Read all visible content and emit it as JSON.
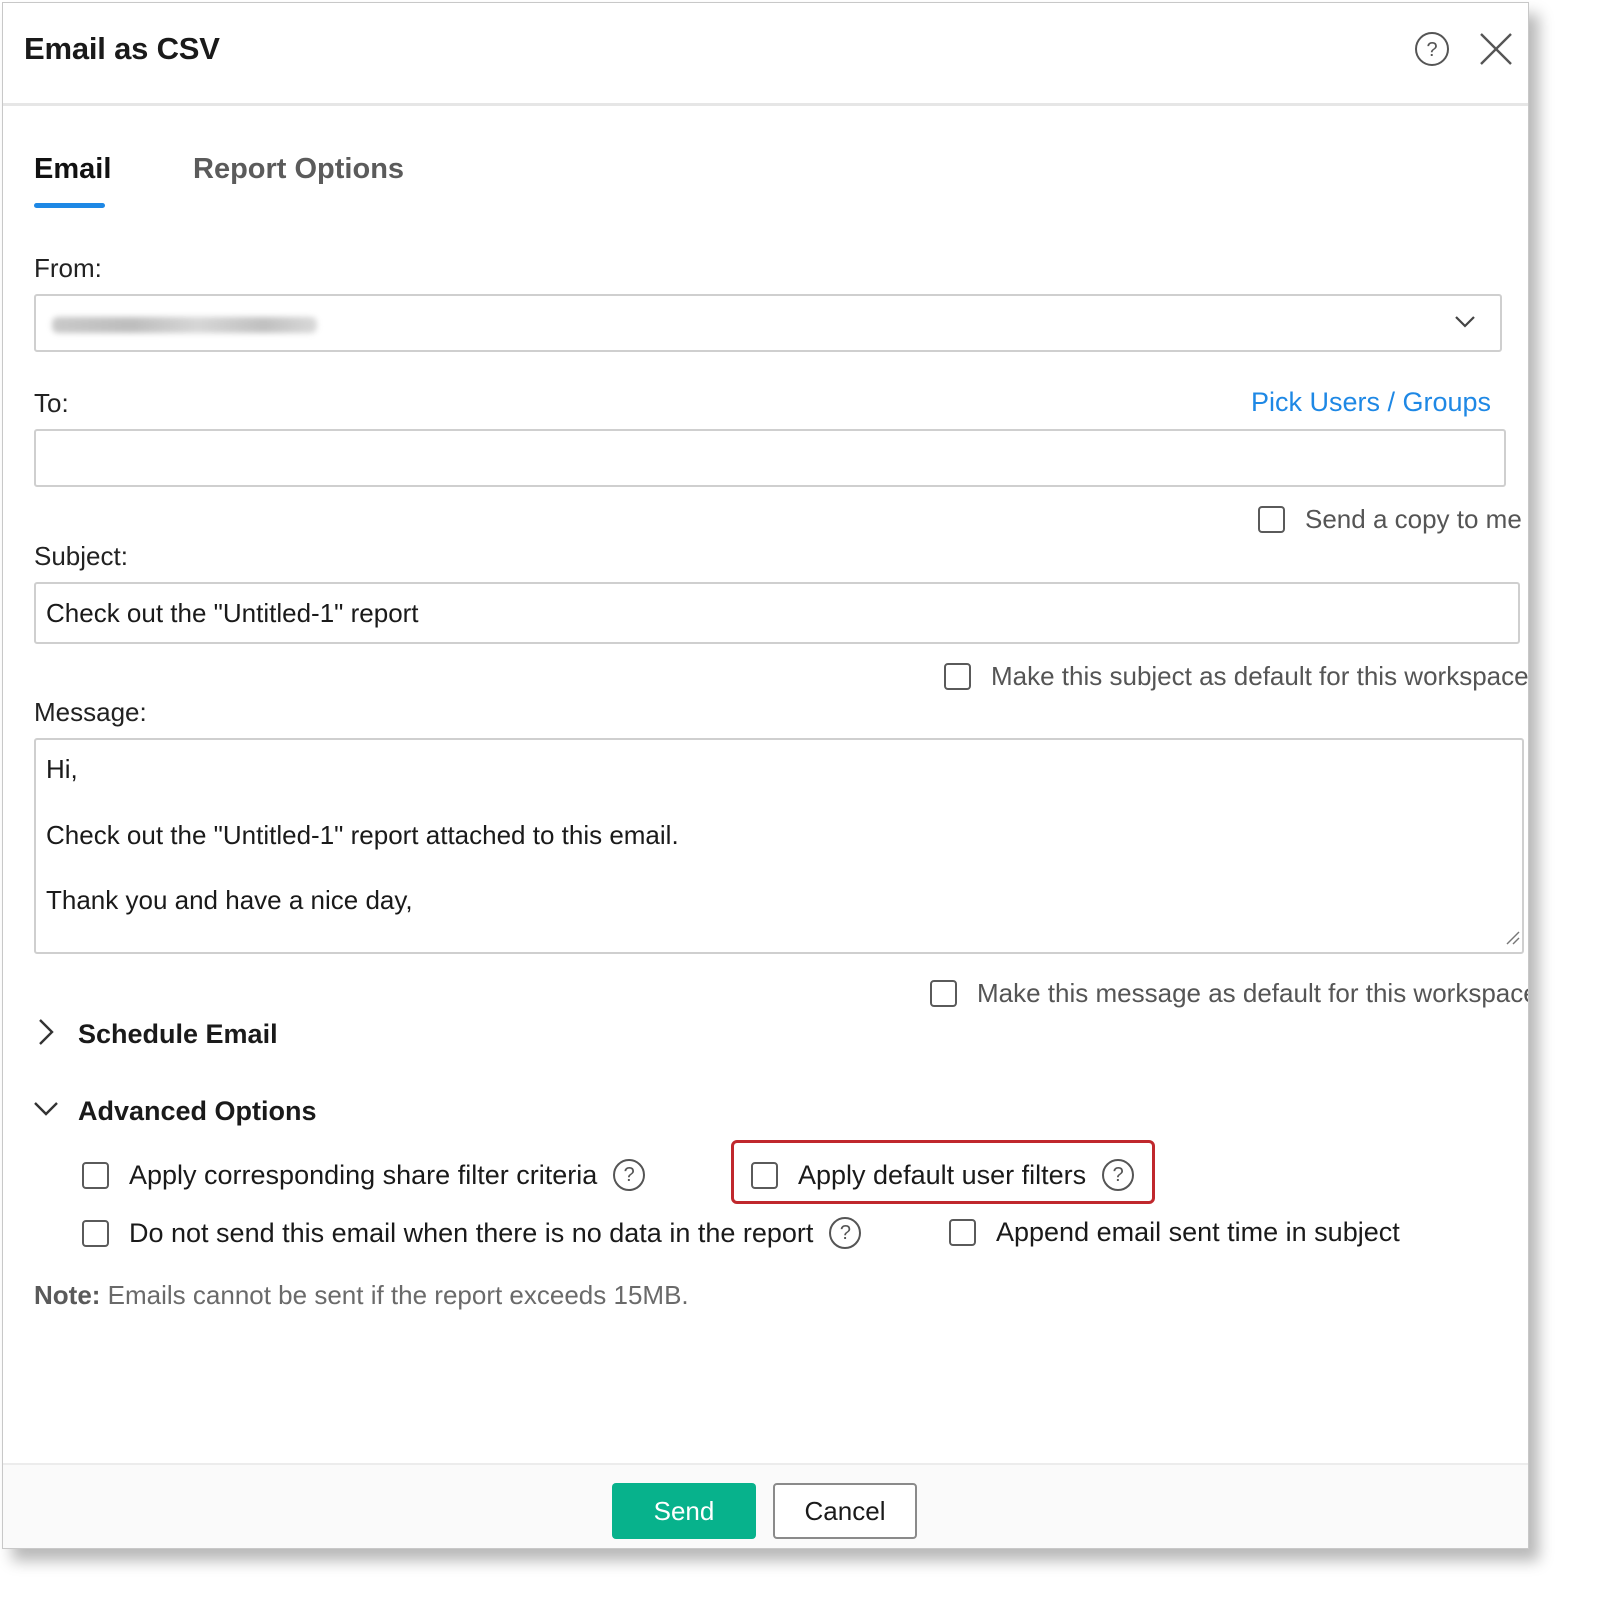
{
  "dialog": {
    "title": "Email as CSV",
    "help_icon": "question-circle-icon",
    "close_icon": "close-x-icon"
  },
  "tabs": [
    {
      "label": "Email",
      "active": true
    },
    {
      "label": "Report Options",
      "active": false
    }
  ],
  "form": {
    "from_label": "From:",
    "from_value_blurred": true,
    "to_label": "To:",
    "pick_users_link": "Pick Users / Groups",
    "to_value": "",
    "send_copy_label": "Send a copy to me",
    "subject_label": "Subject:",
    "subject_value": "Check out the \"Untitled-1\" report",
    "subject_default_label": "Make this subject as default for this workspace",
    "message_label": "Message:",
    "message_lines": [
      "Hi,",
      "Check out the \"Untitled-1\" report attached to this email.",
      "Thank you and have a nice day,"
    ],
    "message_default_label": "Make this message as default for this workspace"
  },
  "sections": {
    "schedule_email": {
      "label": "Schedule Email",
      "expanded": false
    },
    "advanced_options": {
      "label": "Advanced Options",
      "expanded": true
    }
  },
  "advanced": {
    "share_filter_label": "Apply corresponding share filter criteria",
    "default_user_filters_label": "Apply default user filters",
    "no_data_label": "Do not send this email when there is no data in the report",
    "append_time_label": "Append email sent time in subject"
  },
  "note": {
    "prefix": "Note:",
    "text": " Emails cannot be sent if the report exceeds 15MB."
  },
  "footer": {
    "send_label": "Send",
    "cancel_label": "Cancel"
  },
  "colors": {
    "accent_blue": "#1e88e5",
    "send_green": "#07b28c",
    "highlight_red": "#c0282d"
  }
}
